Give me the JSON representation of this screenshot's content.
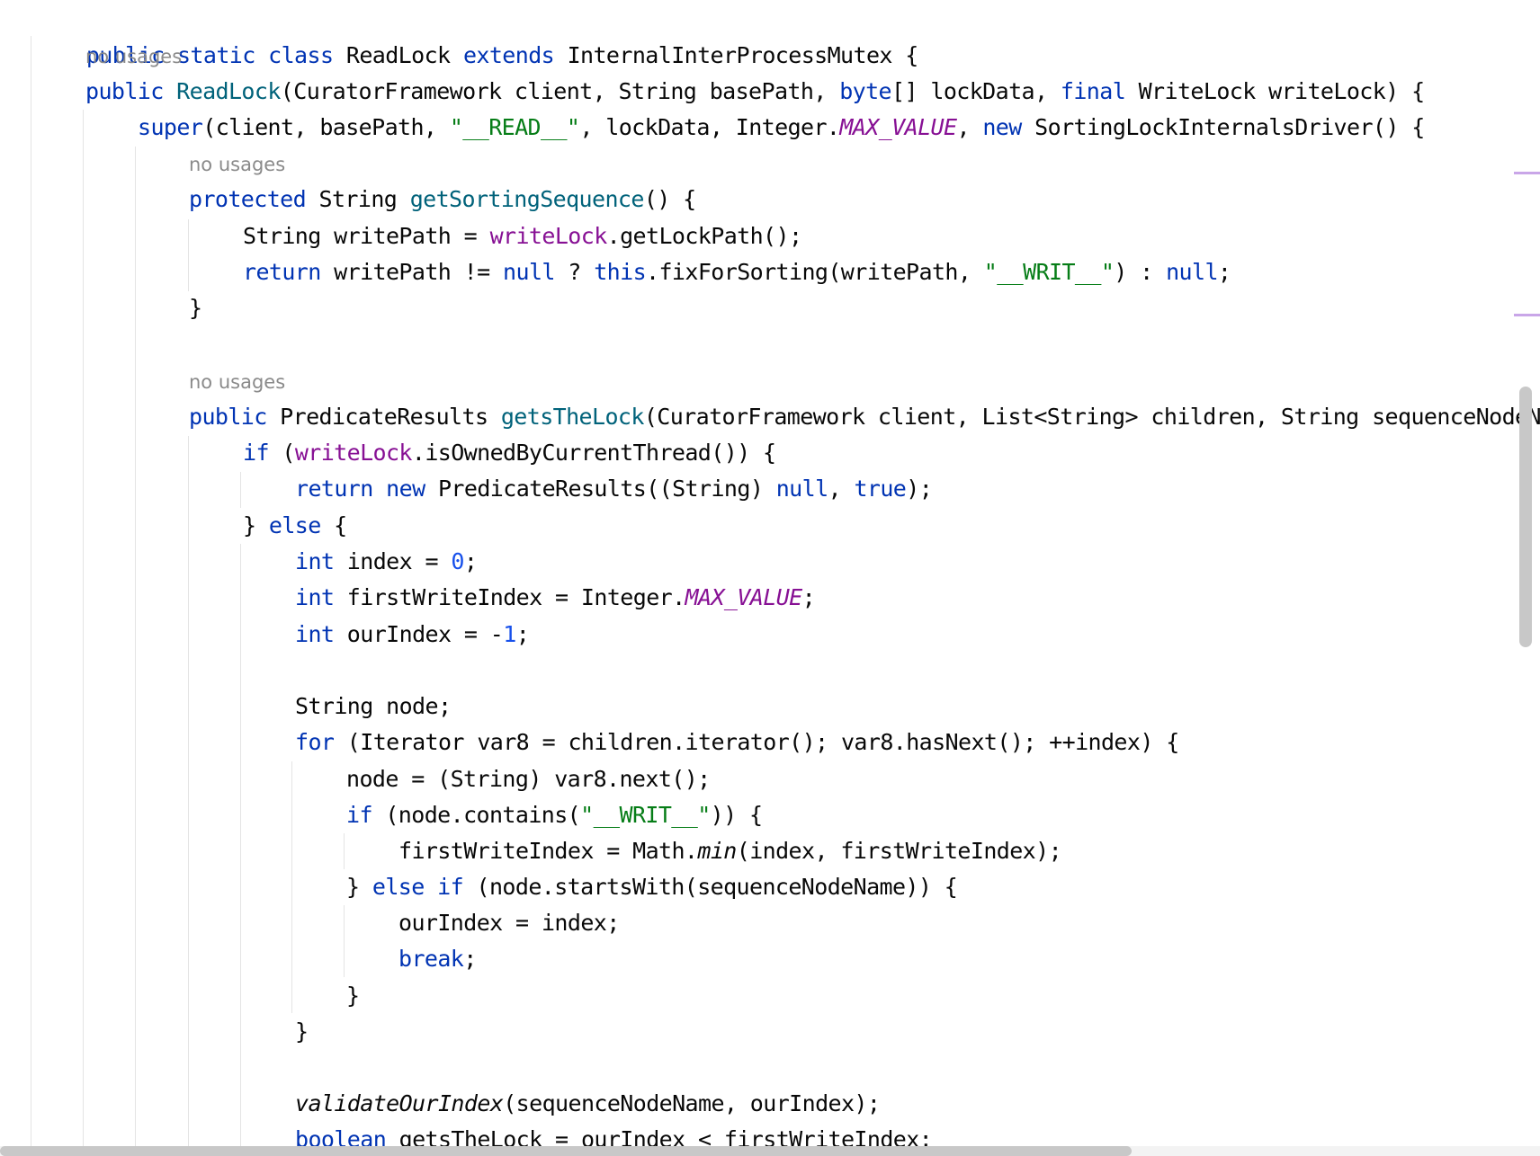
{
  "hints": {
    "no_usages": "no usages"
  },
  "code": {
    "l1": [
      "public",
      "static",
      "class",
      "ReadLock",
      "extends",
      "InternalInterProcessMutex {"
    ],
    "l2": [
      "public",
      "ReadLock",
      "(CuratorFramework client, String basePath, ",
      "byte",
      "[] lockData, ",
      "final",
      " WriteLock writeLock) {"
    ],
    "l3": [
      "super",
      "(client, basePath, ",
      "\"__READ__\"",
      ", lockData, Integer.",
      "MAX_VALUE",
      ", ",
      "new",
      " SortingLockInternalsDriver() {"
    ],
    "l4": [
      "protected",
      " String ",
      "getSortingSequence",
      "() {"
    ],
    "l5": [
      "String writePath = ",
      "writeLock",
      ".getLockPath();"
    ],
    "l6": [
      "return",
      " writePath != ",
      "null",
      " ? ",
      "this",
      ".fixForSorting(writePath, ",
      "\"__WRIT__\"",
      ") : ",
      "null",
      ";"
    ],
    "l7": "}",
    "l8": [
      "public",
      " PredicateResults ",
      "getsTheLock",
      "(CuratorFramework client, List<String> children, String sequenceNodeN"
    ],
    "l9": [
      "if",
      " (",
      "writeLock",
      ".isOwnedByCurrentThread()) {"
    ],
    "l10": [
      "return",
      " ",
      "new",
      " PredicateResults((String) ",
      "null",
      ", ",
      "true",
      ");"
    ],
    "l11": [
      "} ",
      "else",
      " {"
    ],
    "l12": [
      "int",
      " index = ",
      "0",
      ";"
    ],
    "l13": [
      "int",
      " firstWriteIndex = Integer.",
      "MAX_VALUE",
      ";"
    ],
    "l14": [
      "int",
      " ourIndex = -",
      "1",
      ";"
    ],
    "l15": "String node;",
    "l16": [
      "for",
      " (Iterator var8 = children.iterator(); var8.hasNext(); ++index) {"
    ],
    "l17": "node = (String) var8.next();",
    "l18": [
      "if",
      " (node.contains(",
      "\"__WRIT__\"",
      ")) {"
    ],
    "l19": [
      "firstWriteIndex = Math.",
      "min",
      "(index, firstWriteIndex);"
    ],
    "l20": [
      "} ",
      "else",
      " ",
      "if",
      " (node.startsWith(sequenceNodeName)) {"
    ],
    "l21": "ourIndex = index;",
    "l22": [
      "break",
      ";"
    ],
    "l23": "}",
    "l24": "}",
    "l25": [
      "validateOurIndex",
      "(sequenceNodeName, ourIndex);"
    ],
    "l26": [
      "boolean",
      " getsTheLock = ourIndex < firstWriteIndex;"
    ]
  }
}
